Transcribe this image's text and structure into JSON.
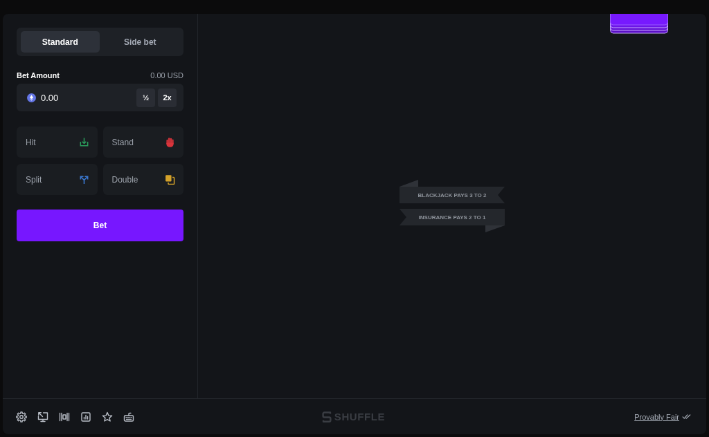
{
  "mode_tabs": [
    {
      "label": "Standard",
      "selected": true
    },
    {
      "label": "Side bet",
      "selected": false
    }
  ],
  "bet_amount": {
    "label": "Bet Amount",
    "converted": "0.00 USD",
    "value": "0.00",
    "quick_buttons": [
      "½",
      "2x"
    ]
  },
  "actions": [
    {
      "label": "Hit",
      "color": "#2a9d5c"
    },
    {
      "label": "Stand",
      "color": "#d9343b"
    },
    {
      "label": "Split",
      "color": "#3a78d0"
    },
    {
      "label": "Double",
      "color": "#d4a22a"
    }
  ],
  "bet_button": {
    "label": "Bet"
  },
  "table": {
    "banners": [
      "BLACKJACK PAYS 3 TO 2",
      "INSURANCE PAYS 2 TO 1"
    ]
  },
  "footer": {
    "logo": "SHUFFLE",
    "link": "Provably Fair"
  }
}
